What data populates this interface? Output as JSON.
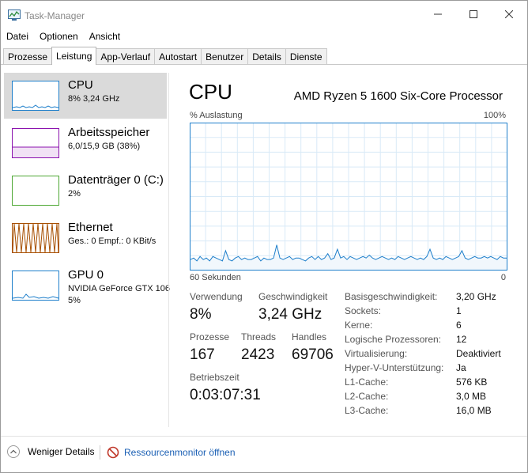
{
  "window": {
    "title": "Task-Manager"
  },
  "menu": [
    "Datei",
    "Optionen",
    "Ansicht"
  ],
  "tabs": [
    {
      "label": "Prozesse",
      "active": false
    },
    {
      "label": "Leistung",
      "active": true
    },
    {
      "label": "App-Verlauf",
      "active": false
    },
    {
      "label": "Autostart",
      "active": false
    },
    {
      "label": "Benutzer",
      "active": false
    },
    {
      "label": "Details",
      "active": false
    },
    {
      "label": "Dienste",
      "active": false
    }
  ],
  "sidebar": [
    {
      "name": "CPU",
      "sub": "8%  3,24 GHz",
      "sub2": "",
      "color": "#1e7fcb",
      "active": true
    },
    {
      "name": "Arbeitsspeicher",
      "sub": "6,0/15,9 GB (38%)",
      "sub2": "",
      "color": "#8b12ae",
      "active": false
    },
    {
      "name": "Datenträger 0 (C:)",
      "sub": "2%",
      "sub2": "",
      "color": "#4da733",
      "active": false
    },
    {
      "name": "Ethernet",
      "sub": "Ges.: 0  Empf.: 0 KBit/s",
      "sub2": "",
      "color": "#a74f01",
      "active": false
    },
    {
      "name": "GPU 0",
      "sub": "NVIDIA GeForce GTX 106",
      "sub2": "5%",
      "color": "#1e7fcb",
      "active": false
    }
  ],
  "main": {
    "title": "CPU",
    "processor": "AMD Ryzen 5 1600 Six-Core Processor",
    "graph_label": "% Auslastung",
    "graph_max": "100%",
    "graph_time": "60 Sekunden",
    "graph_min": "0",
    "graph_color": "#1e7fcb",
    "usage_series": [
      7,
      8,
      6,
      9,
      7,
      8,
      6,
      9,
      8,
      7,
      6,
      13,
      7,
      6,
      8,
      9,
      7,
      8,
      7,
      7,
      8,
      9,
      6,
      8,
      7,
      7,
      8,
      17,
      8,
      7,
      8,
      9,
      7,
      8,
      8,
      7,
      6,
      8,
      9,
      7,
      9,
      7,
      8,
      11,
      7,
      8,
      14,
      8,
      9,
      7,
      9,
      8,
      7,
      8,
      9,
      8,
      10,
      8,
      7,
      8,
      9,
      8,
      7,
      8,
      7,
      9,
      8,
      7,
      8,
      9,
      8,
      7,
      8,
      7,
      9,
      14,
      8,
      7,
      8,
      7,
      9,
      8,
      7,
      8,
      9,
      13,
      8,
      7,
      8,
      9,
      8,
      8,
      9,
      8,
      9,
      8,
      7,
      9,
      8,
      8
    ]
  },
  "stats": {
    "usage_label": "Verwendung",
    "usage_value": "8%",
    "speed_label": "Geschwindigkeit",
    "speed_value": "3,24 GHz",
    "processes_label": "Prozesse",
    "processes_value": "167",
    "threads_label": "Threads",
    "threads_value": "2423",
    "handles_label": "Handles",
    "handles_value": "69706",
    "uptime_label": "Betriebszeit",
    "uptime_value": "0:03:07:31"
  },
  "details": [
    {
      "label": "Basisgeschwindigkeit:",
      "value": "3,20 GHz"
    },
    {
      "label": "Sockets:",
      "value": "1"
    },
    {
      "label": "Kerne:",
      "value": "6"
    },
    {
      "label": "Logische Prozessoren:",
      "value": "12"
    },
    {
      "label": "Virtualisierung:",
      "value": "Deaktiviert"
    },
    {
      "label": "Hyper-V-Unterstützung:",
      "value": "Ja"
    },
    {
      "label": "L1-Cache:",
      "value": "576 KB"
    },
    {
      "label": "L2-Cache:",
      "value": "3,0 MB"
    },
    {
      "label": "L3-Cache:",
      "value": "16,0 MB"
    }
  ],
  "footer": {
    "fewer_details": "Weniger Details",
    "resource_monitor": "Ressourcenmonitor öffnen"
  }
}
